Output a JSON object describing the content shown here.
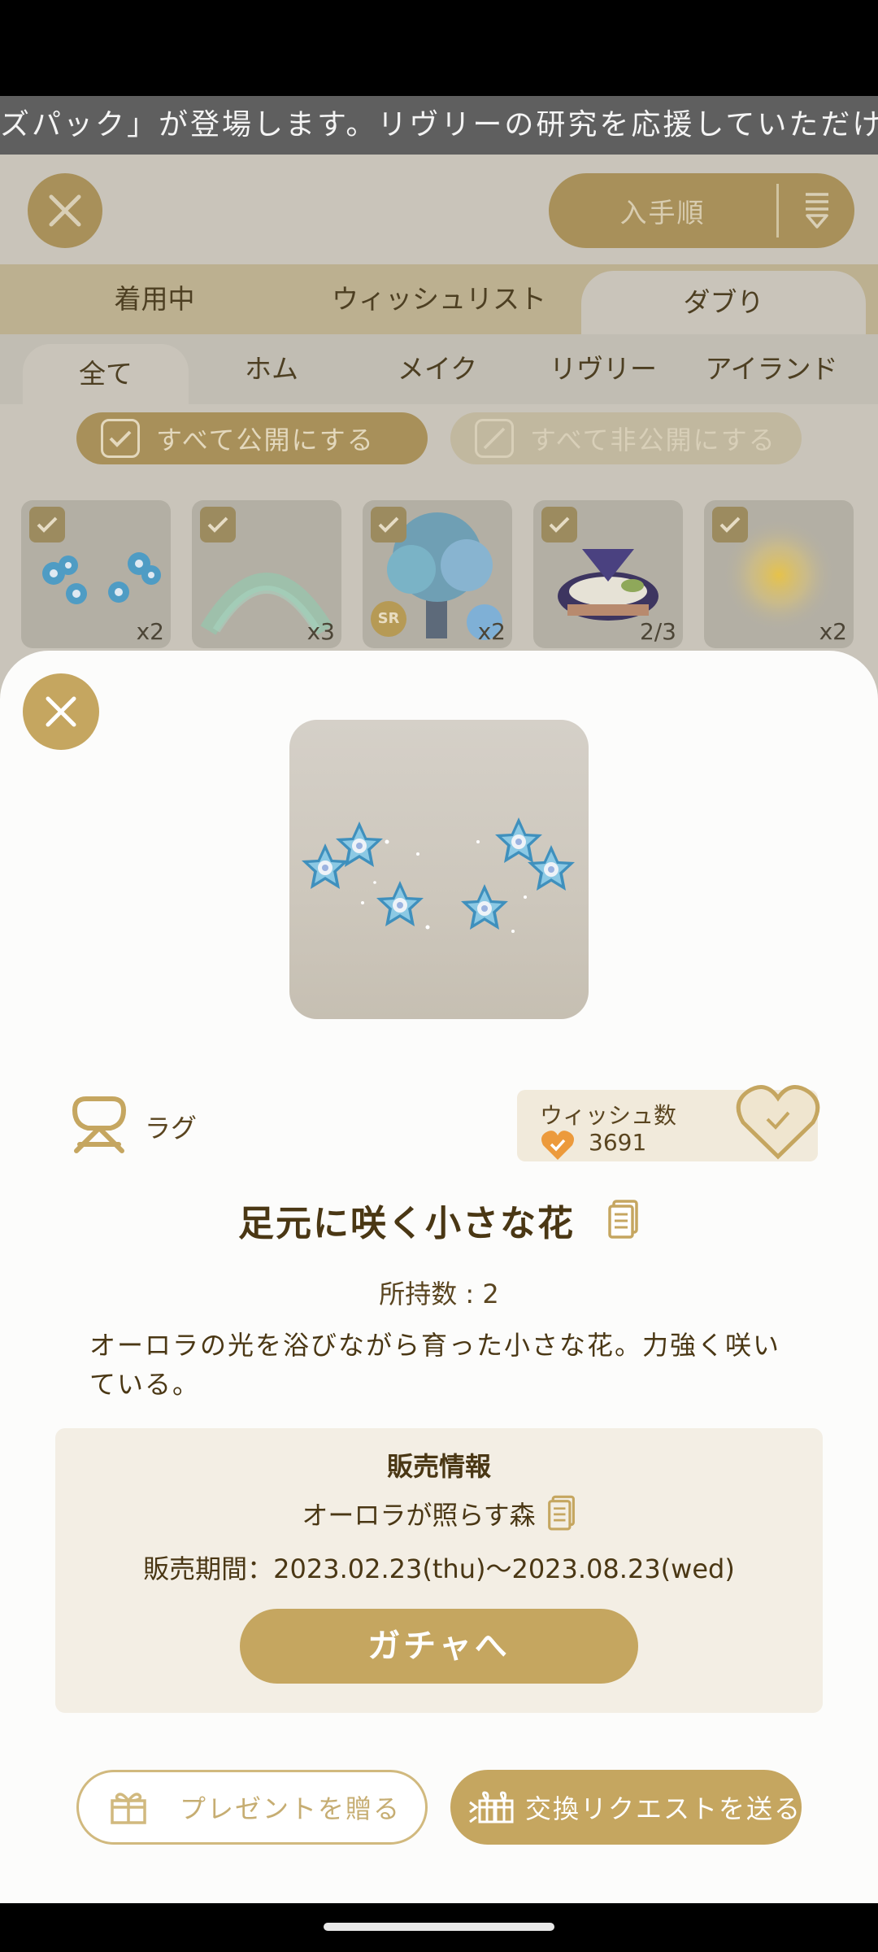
{
  "ticker": {
    "text": "ズパック」が登場します。リヴリーの研究を応援していただける方はぜ"
  },
  "header": {
    "sort_label": "入手順"
  },
  "tabs_primary": [
    {
      "label": "着用中",
      "active": false
    },
    {
      "label": "ウィッシュリスト",
      "active": false
    },
    {
      "label": "ダブり",
      "active": true
    }
  ],
  "tabs_secondary": [
    {
      "label": "全て",
      "active": true
    },
    {
      "label": "ホム",
      "active": false
    },
    {
      "label": "メイク",
      "active": false
    },
    {
      "label": "リヴリー",
      "active": false
    },
    {
      "label": "アイランド",
      "active": false
    }
  ],
  "visibility": {
    "public_all": "すべて公開にする",
    "private_all": "すべて非公開にする"
  },
  "items": [
    {
      "count": "x2",
      "art": "blue-flowers"
    },
    {
      "count": "x3",
      "art": "aurora-arc"
    },
    {
      "count": "x2",
      "art": "hydrangea-tree",
      "badge": "SR"
    },
    {
      "count": "2/3",
      "art": "purple-headband"
    },
    {
      "count": "x2",
      "art": "yellow-glow"
    }
  ],
  "detail": {
    "category": "ラグ",
    "wish_title": "ウィッシュ数",
    "wish_count": "3691",
    "name": "足元に咲く小さな花",
    "owned": "所持数 : 2",
    "description": "オーロラの光を浴びながら育った小さな花。力強く咲いている。",
    "sale": {
      "title": "販売情報",
      "source": "オーロラが照らす森",
      "period": "販売期間：2023.02.23(thu)〜2023.08.23(wed)",
      "gacha_button": "ガチャへ"
    },
    "present_button": "プレゼントを贈る",
    "trade_button": "交換リクエストを送る"
  },
  "colors": {
    "accent": "#c5a660",
    "dimmed_accent": "#a8905a",
    "text_brown": "#4a3714"
  }
}
